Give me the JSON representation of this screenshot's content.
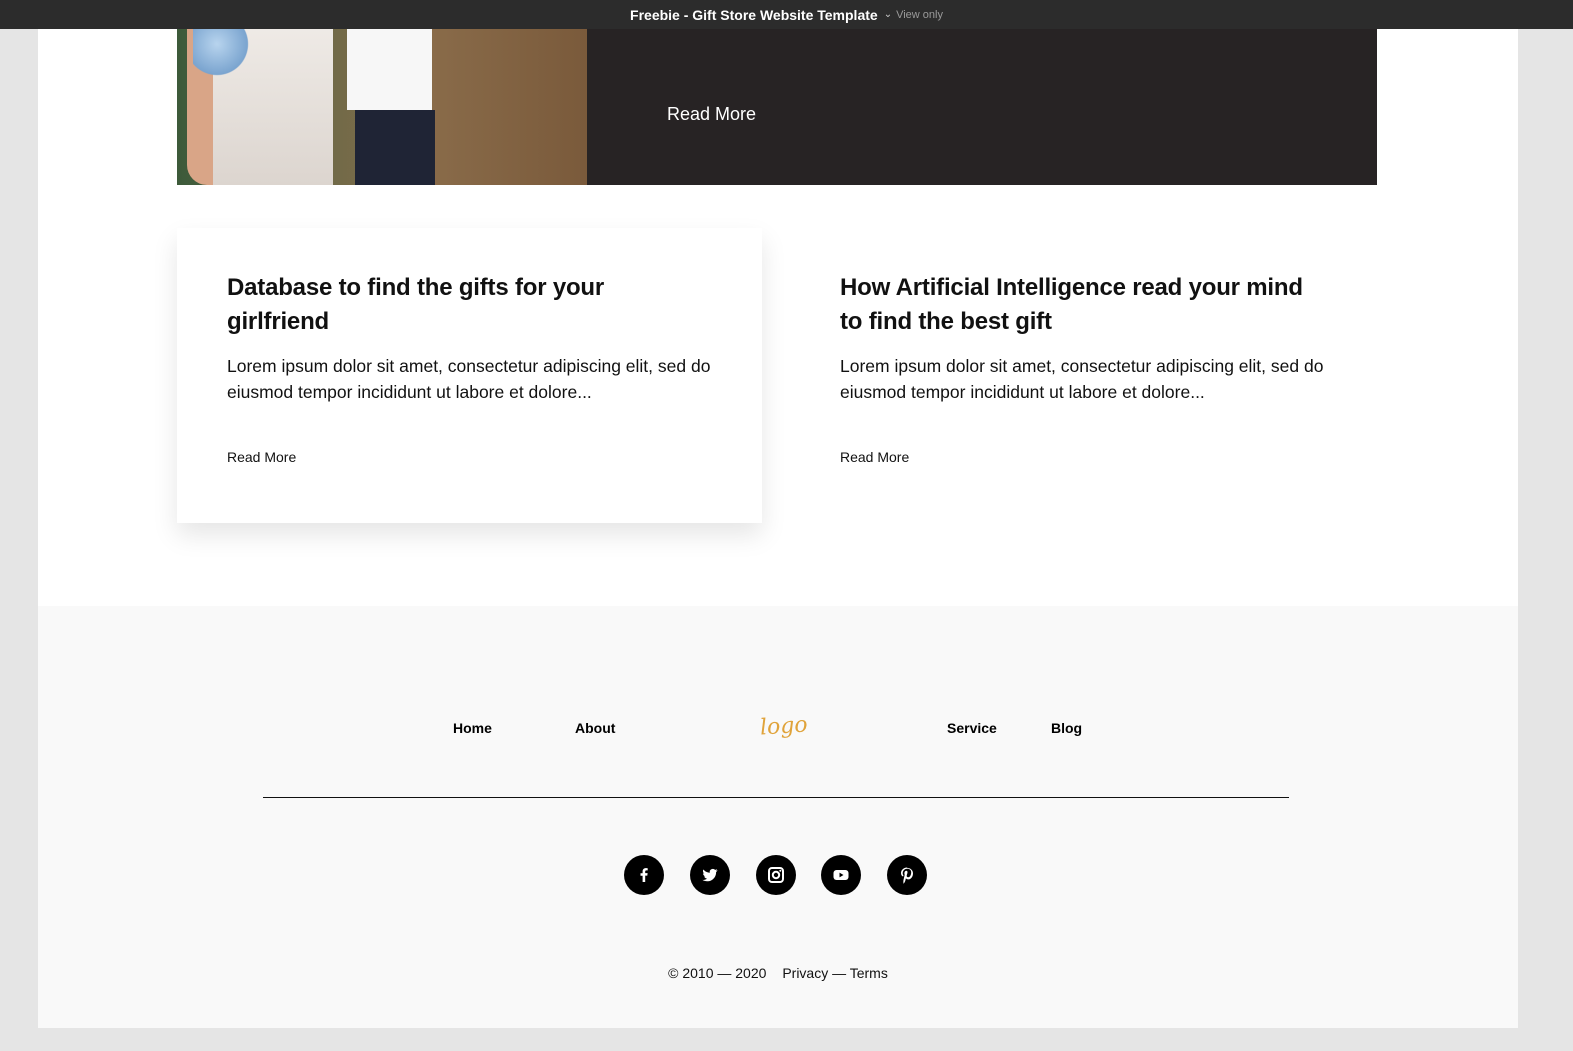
{
  "window": {
    "title": "Freebie - Gift Store Website Template",
    "mode": "View only"
  },
  "hero": {
    "read_more": "Read More"
  },
  "articles": [
    {
      "title": "Database to find the gifts for your girlfriend",
      "excerpt": "Lorem ipsum dolor sit amet, consectetur adipiscing elit, sed do eiusmod tempor incididunt ut labore et dolore...",
      "read_more": "Read More"
    },
    {
      "title": "How Artificial Intelligence read your mind to find the best gift",
      "excerpt": "Lorem ipsum dolor sit amet, consectetur adipiscing elit, sed do eiusmod tempor incididunt ut labore et dolore...",
      "read_more": "Read More"
    }
  ],
  "footer": {
    "nav": {
      "home": "Home",
      "about": "About",
      "service": "Service",
      "blog": "Blog"
    },
    "logo": "logo",
    "social_icons": [
      "facebook-icon",
      "twitter-icon",
      "instagram-icon",
      "youtube-icon",
      "pinterest-icon"
    ],
    "copyright": "© 2010 — 2020",
    "legal": "Privacy — Terms"
  },
  "colors": {
    "dark_panel": "#272324",
    "logo": "#e0a33a",
    "footer_bg": "#f9f9f9"
  }
}
